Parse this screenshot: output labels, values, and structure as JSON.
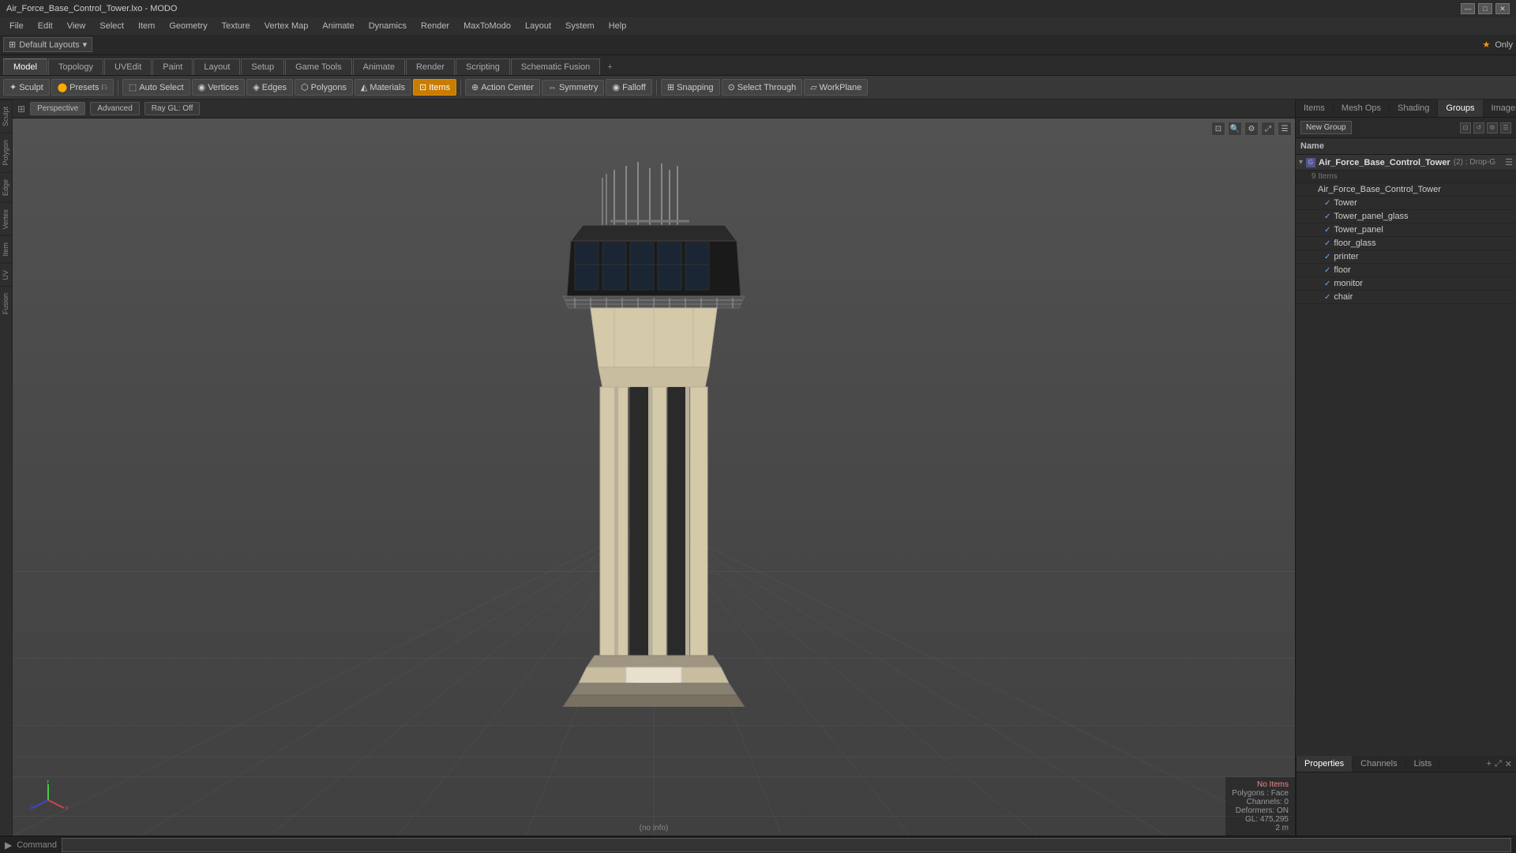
{
  "titlebar": {
    "title": "Air_Force_Base_Control_Tower.lxo - MODO",
    "controls": [
      "—",
      "□",
      "✕"
    ]
  },
  "menubar": {
    "items": [
      "File",
      "Edit",
      "View",
      "Select",
      "Item",
      "Geometry",
      "Texture",
      "Vertex Map",
      "Animate",
      "Dynamics",
      "Render",
      "MaxToModo",
      "Layout",
      "System",
      "Help"
    ]
  },
  "layout": {
    "selector": "Default Layouts",
    "selector_icon": "▾",
    "right_label": "Only",
    "star": "★"
  },
  "mode_tabs": {
    "items": [
      "Model",
      "Topology",
      "UVEdit",
      "Paint",
      "Layout",
      "Setup",
      "Game Tools",
      "Animate",
      "Render",
      "Scripting",
      "Schematic Fusion"
    ],
    "active": "Model",
    "add_icon": "+"
  },
  "toolbar": {
    "sculpt_label": "Sculpt",
    "presets_label": "Presets",
    "presets_icon": "⬤",
    "auto_select_label": "Auto Select",
    "vertices_label": "Vertices",
    "edges_label": "Edges",
    "polygons_label": "Polygons",
    "materials_label": "Materials",
    "items_label": "Items",
    "action_center_label": "Action Center",
    "symmetry_label": "Symmetry",
    "falloff_label": "Falloff",
    "snapping_label": "Snapping",
    "select_through_label": "Select Through",
    "workplane_label": "WorkPlane"
  },
  "viewport": {
    "mode": "Perspective",
    "advanced_label": "Advanced",
    "ray_gl_label": "Ray GL: Off"
  },
  "left_sidebar": {
    "tabs": [
      "Sculpt",
      "Polygon",
      "Edge",
      "Vertex",
      "Item",
      "UV",
      "Fusion"
    ]
  },
  "status": {
    "no_items": "No Items",
    "polygons": "Polygons : Face",
    "channels": "Channels: 0",
    "deformers": "Deformers: ON",
    "gl": "GL: 475,295",
    "distance": "2 m",
    "info": "(no info)"
  },
  "right_panel": {
    "tabs": [
      "Items",
      "Mesh Ops",
      "Shading",
      "Groups",
      "Images"
    ],
    "active": "Groups",
    "add_icon": "+",
    "new_group_label": "New Group",
    "name_header": "Name",
    "group_name": "Air_Force_Base_Control_Tower",
    "group_count": "2",
    "group_sub": "Drop-G",
    "items_count": "9 Items",
    "items": [
      {
        "name": "Air_Force_Base_Control_Tower",
        "checked": false,
        "indent": 0
      },
      {
        "name": "Tower",
        "checked": true,
        "indent": 1
      },
      {
        "name": "Tower_panel_glass",
        "checked": true,
        "indent": 1
      },
      {
        "name": "Tower_panel",
        "checked": true,
        "indent": 1
      },
      {
        "name": "floor_glass",
        "checked": true,
        "indent": 1
      },
      {
        "name": "printer",
        "checked": true,
        "indent": 1
      },
      {
        "name": "floor",
        "checked": true,
        "indent": 1
      },
      {
        "name": "monitor",
        "checked": true,
        "indent": 1
      },
      {
        "name": "chair",
        "checked": true,
        "indent": 1
      }
    ]
  },
  "bottom_right": {
    "tabs": [
      "Properties",
      "Channels",
      "Lists"
    ],
    "active": "Properties",
    "add_icon": "+",
    "expand_icon": "⤢",
    "close_icon": "✕"
  },
  "cmdbar": {
    "label": "Command",
    "placeholder": "",
    "icon": "▶"
  }
}
